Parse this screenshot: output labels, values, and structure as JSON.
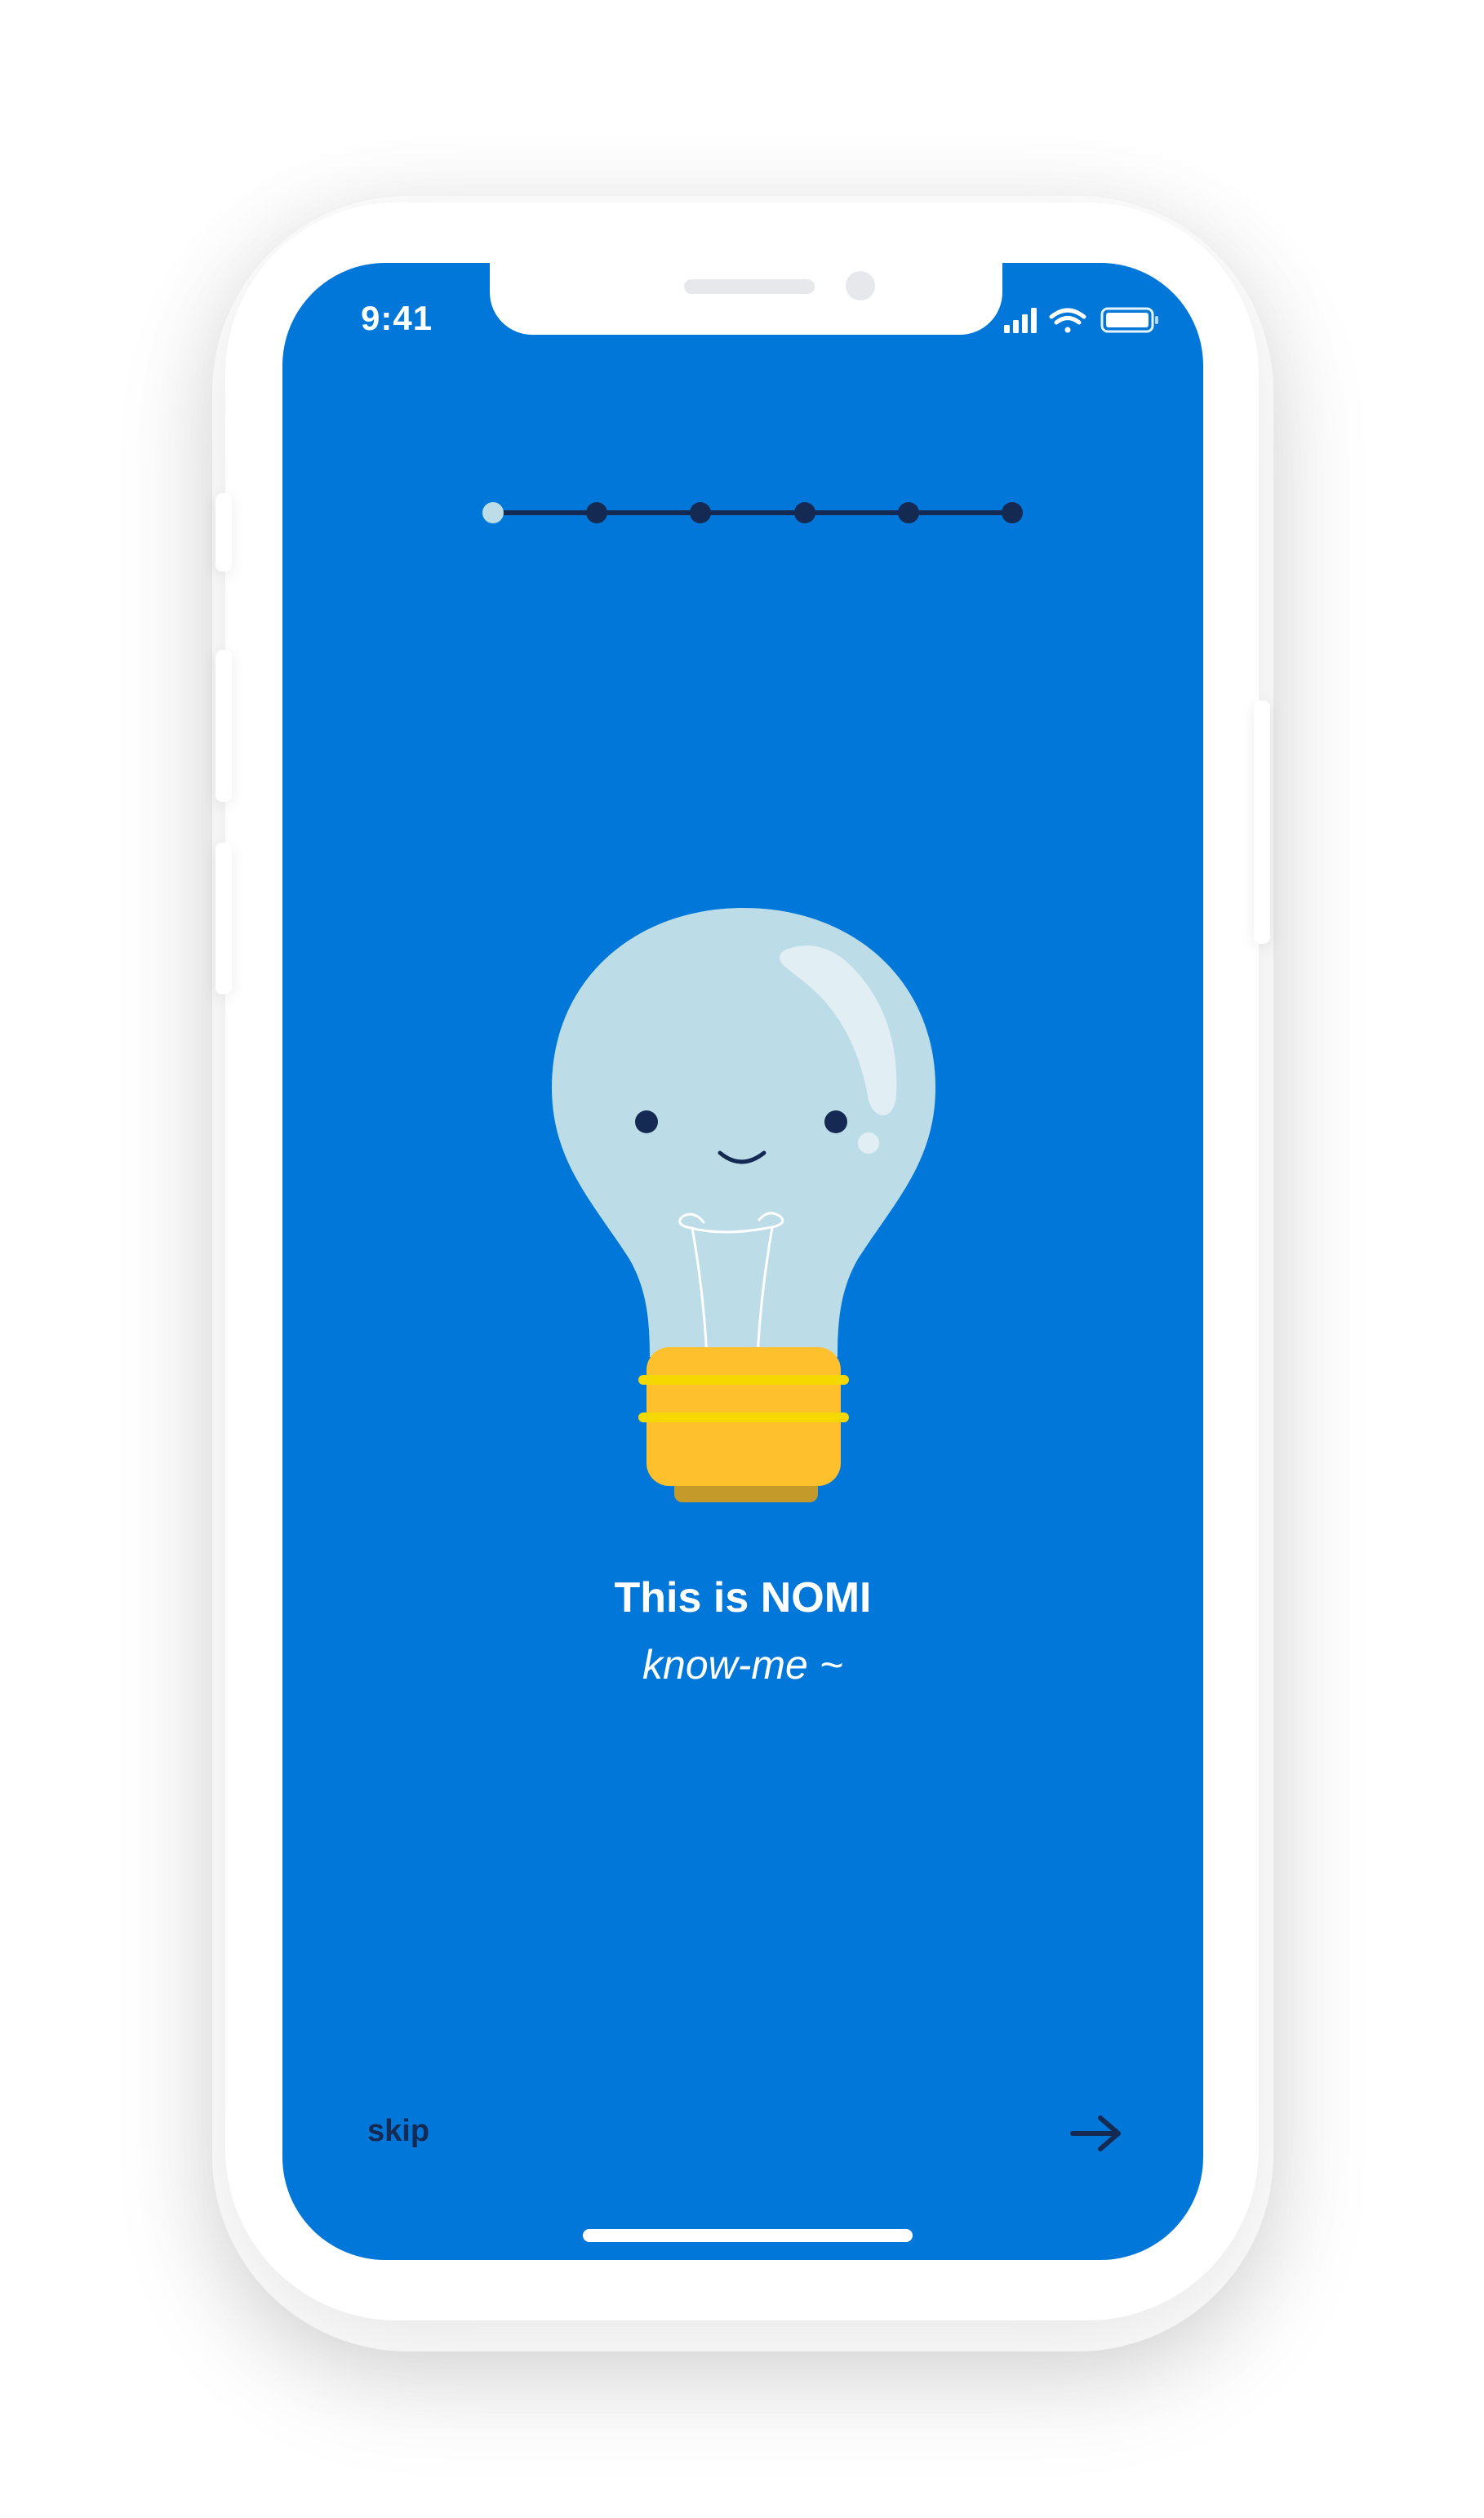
{
  "status_bar": {
    "time": "9:41",
    "icons": [
      "cellular-signal-icon",
      "wifi-icon",
      "battery-icon"
    ]
  },
  "onboarding": {
    "progress": {
      "total_steps": 6,
      "current_step": 1
    },
    "illustration": "lightbulb-mascot",
    "title": "This is NOMI",
    "subtitle": "know-me ~"
  },
  "footer": {
    "skip_label": "skip",
    "next_icon": "arrow-right-icon"
  },
  "colors": {
    "background": "#0077d9",
    "dark_accent": "#152a52",
    "active_dot": "#bcdde7",
    "bulb_glass": "#bcdde7",
    "bulb_base": "#fec02c",
    "bulb_band": "#f5d800",
    "bulb_shadow": "#c49a2a"
  }
}
